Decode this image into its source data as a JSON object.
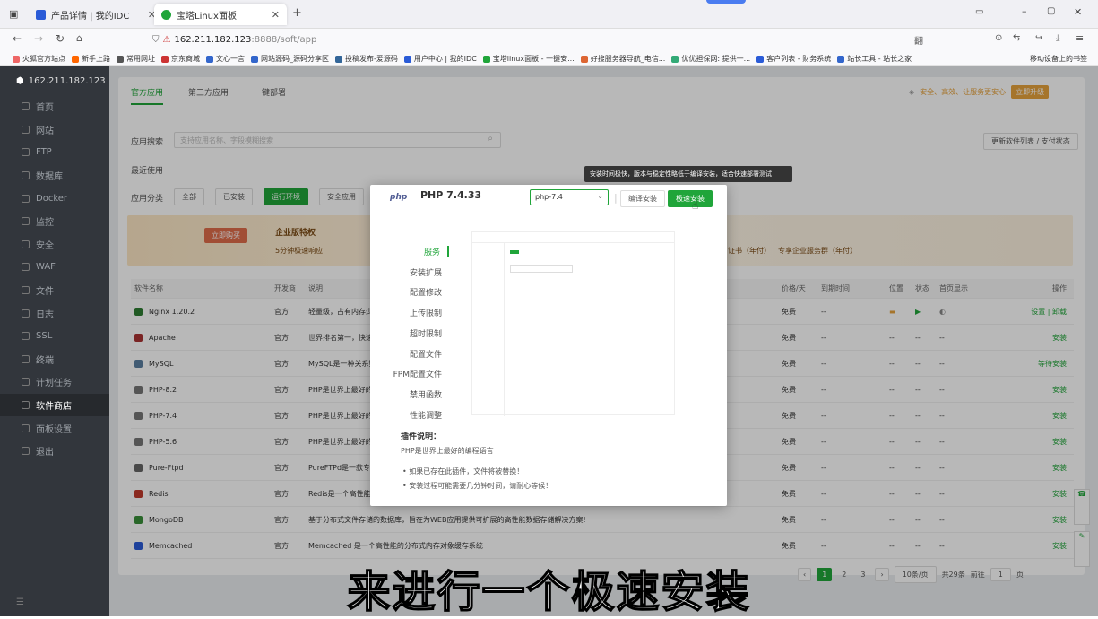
{
  "browser": {
    "tabs": [
      {
        "title": "产品详情 | 我的IDC",
        "active": false
      },
      {
        "title": "宝塔Linux面板",
        "active": true
      }
    ],
    "url_host": "162.211.182.123",
    "url_rest": ":8888/soft/app",
    "bookmarks": [
      "火狐官方站点",
      "新手上路",
      "常用网址",
      "京东商城",
      "文心一言",
      "网站源码_源码分享区",
      "投稿发布-爱源码",
      "用户中心 | 我的IDC",
      "宝塔linux面板 - 一键安...",
      "好搜服务器导航_电信...",
      "优优担保网: 提供一...",
      "客户列表 - 财务系统",
      "站长工具 - 站长之家"
    ],
    "mobile_bookmarks": "移动设备上的书签"
  },
  "sidebar": {
    "server": "162.211.182.123",
    "badge": "1",
    "items": [
      {
        "label": "首页"
      },
      {
        "label": "网站"
      },
      {
        "label": "FTP"
      },
      {
        "label": "数据库"
      },
      {
        "label": "Docker"
      },
      {
        "label": "监控"
      },
      {
        "label": "安全"
      },
      {
        "label": "WAF"
      },
      {
        "label": "文件"
      },
      {
        "label": "日志"
      },
      {
        "label": "SSL"
      },
      {
        "label": "终端"
      },
      {
        "label": "计划任务"
      },
      {
        "label": "软件商店"
      },
      {
        "label": "面板设置"
      },
      {
        "label": "退出"
      }
    ]
  },
  "store": {
    "tabs": [
      "官方应用",
      "第三方应用",
      "一键部署"
    ],
    "top_right_text": "安全、高效、让服务更安心",
    "top_right_btn": "立即升级",
    "search_label": "应用搜索",
    "search_placeholder": "支持应用名称、字段模糊搜索",
    "update_btn": "更新软件列表 / 支付状态",
    "recent_label": "最近使用",
    "category_label": "应用分类",
    "categories": [
      "全部",
      "已安装",
      "运行环境",
      "安全应用"
    ],
    "banner_title": "企业版特权",
    "banner_btn": "立即购买",
    "banner_item1": "5分钟极速响应",
    "banner_cert": "证书（年付）",
    "banner_enterprise": "专享企业服务群（年付）",
    "headers": {
      "name": "软件名称",
      "dev": "开发商",
      "desc": "说明",
      "price": "价格/天",
      "expire": "到期时间",
      "loc": "位置",
      "status": "状态",
      "home": "首页显示",
      "op": "操作"
    },
    "rows": [
      {
        "name": "Nginx 1.20.2",
        "dev": "官方",
        "desc": "轻量级，占有内存少",
        "price": "免费",
        "expire": "--",
        "op": "设置 | 卸载"
      },
      {
        "name": "Apache",
        "dev": "官方",
        "desc": "世界排名第一，快速",
        "price": "免费",
        "expire": "--",
        "op": "安装"
      },
      {
        "name": "MySQL",
        "dev": "官方",
        "desc": "MySQL是一种关系数",
        "price": "免费",
        "expire": "--",
        "op": "等待安装"
      },
      {
        "name": "PHP-8.2",
        "dev": "官方",
        "desc": "PHP是世界上最好的",
        "price": "免费",
        "expire": "--",
        "op": "安装"
      },
      {
        "name": "PHP-7.4",
        "dev": "官方",
        "desc": "PHP是世界上最好的",
        "price": "免费",
        "expire": "--",
        "op": "安装"
      },
      {
        "name": "PHP-5.6",
        "dev": "官方",
        "desc": "PHP是世界上最好的",
        "price": "免费",
        "expire": "--",
        "op": "安装"
      },
      {
        "name": "Pure-Ftpd",
        "dev": "官方",
        "desc": "PureFTPd是一款专注",
        "price": "免费",
        "expire": "--",
        "op": "安装"
      },
      {
        "name": "Redis",
        "dev": "官方",
        "desc": "Redis是一个高性能",
        "price": "免费",
        "expire": "--",
        "op": "安装"
      },
      {
        "name": "MongoDB",
        "dev": "官方",
        "desc": "基于分布式文件存储的数据库，旨在为WEB应用提供可扩展的高性能数据存储解决方案!",
        "price": "免费",
        "expire": "--",
        "op": "安装"
      },
      {
        "name": "Memcached",
        "dev": "官方",
        "desc": "Memcached 是一个高性能的分布式内存对象缓存系统",
        "price": "免费",
        "expire": "--",
        "op": "安装"
      }
    ],
    "pager": {
      "pages": [
        "1",
        "2",
        "3"
      ],
      "per_page": "10条/页",
      "total": "共29条",
      "goto": "前往",
      "goto_value": "1",
      "page_unit": "页"
    }
  },
  "dialog": {
    "logo": "php",
    "title": "PHP 7.4.33",
    "version": "php-7.4",
    "btn_compile": "编译安装",
    "btn_fast": "极速安装",
    "tooltip": "安装时间极快，版本与稳定性略低于编译安装，适合快速部署测试",
    "nav": [
      "服务",
      "安装扩展",
      "配置修改",
      "上传限制",
      "超时限制",
      "配置文件",
      "FPM配置文件",
      "禁用函数",
      "性能调整"
    ],
    "notes_title": "插件说明：",
    "notes_desc": "PHP是世界上最好的编程语言",
    "notes": [
      "如果已存在此插件，文件将被替换！",
      "安装过程可能需要几分钟时间，请耐心等候！"
    ]
  },
  "subtitle": "来进行一个极速安装"
}
